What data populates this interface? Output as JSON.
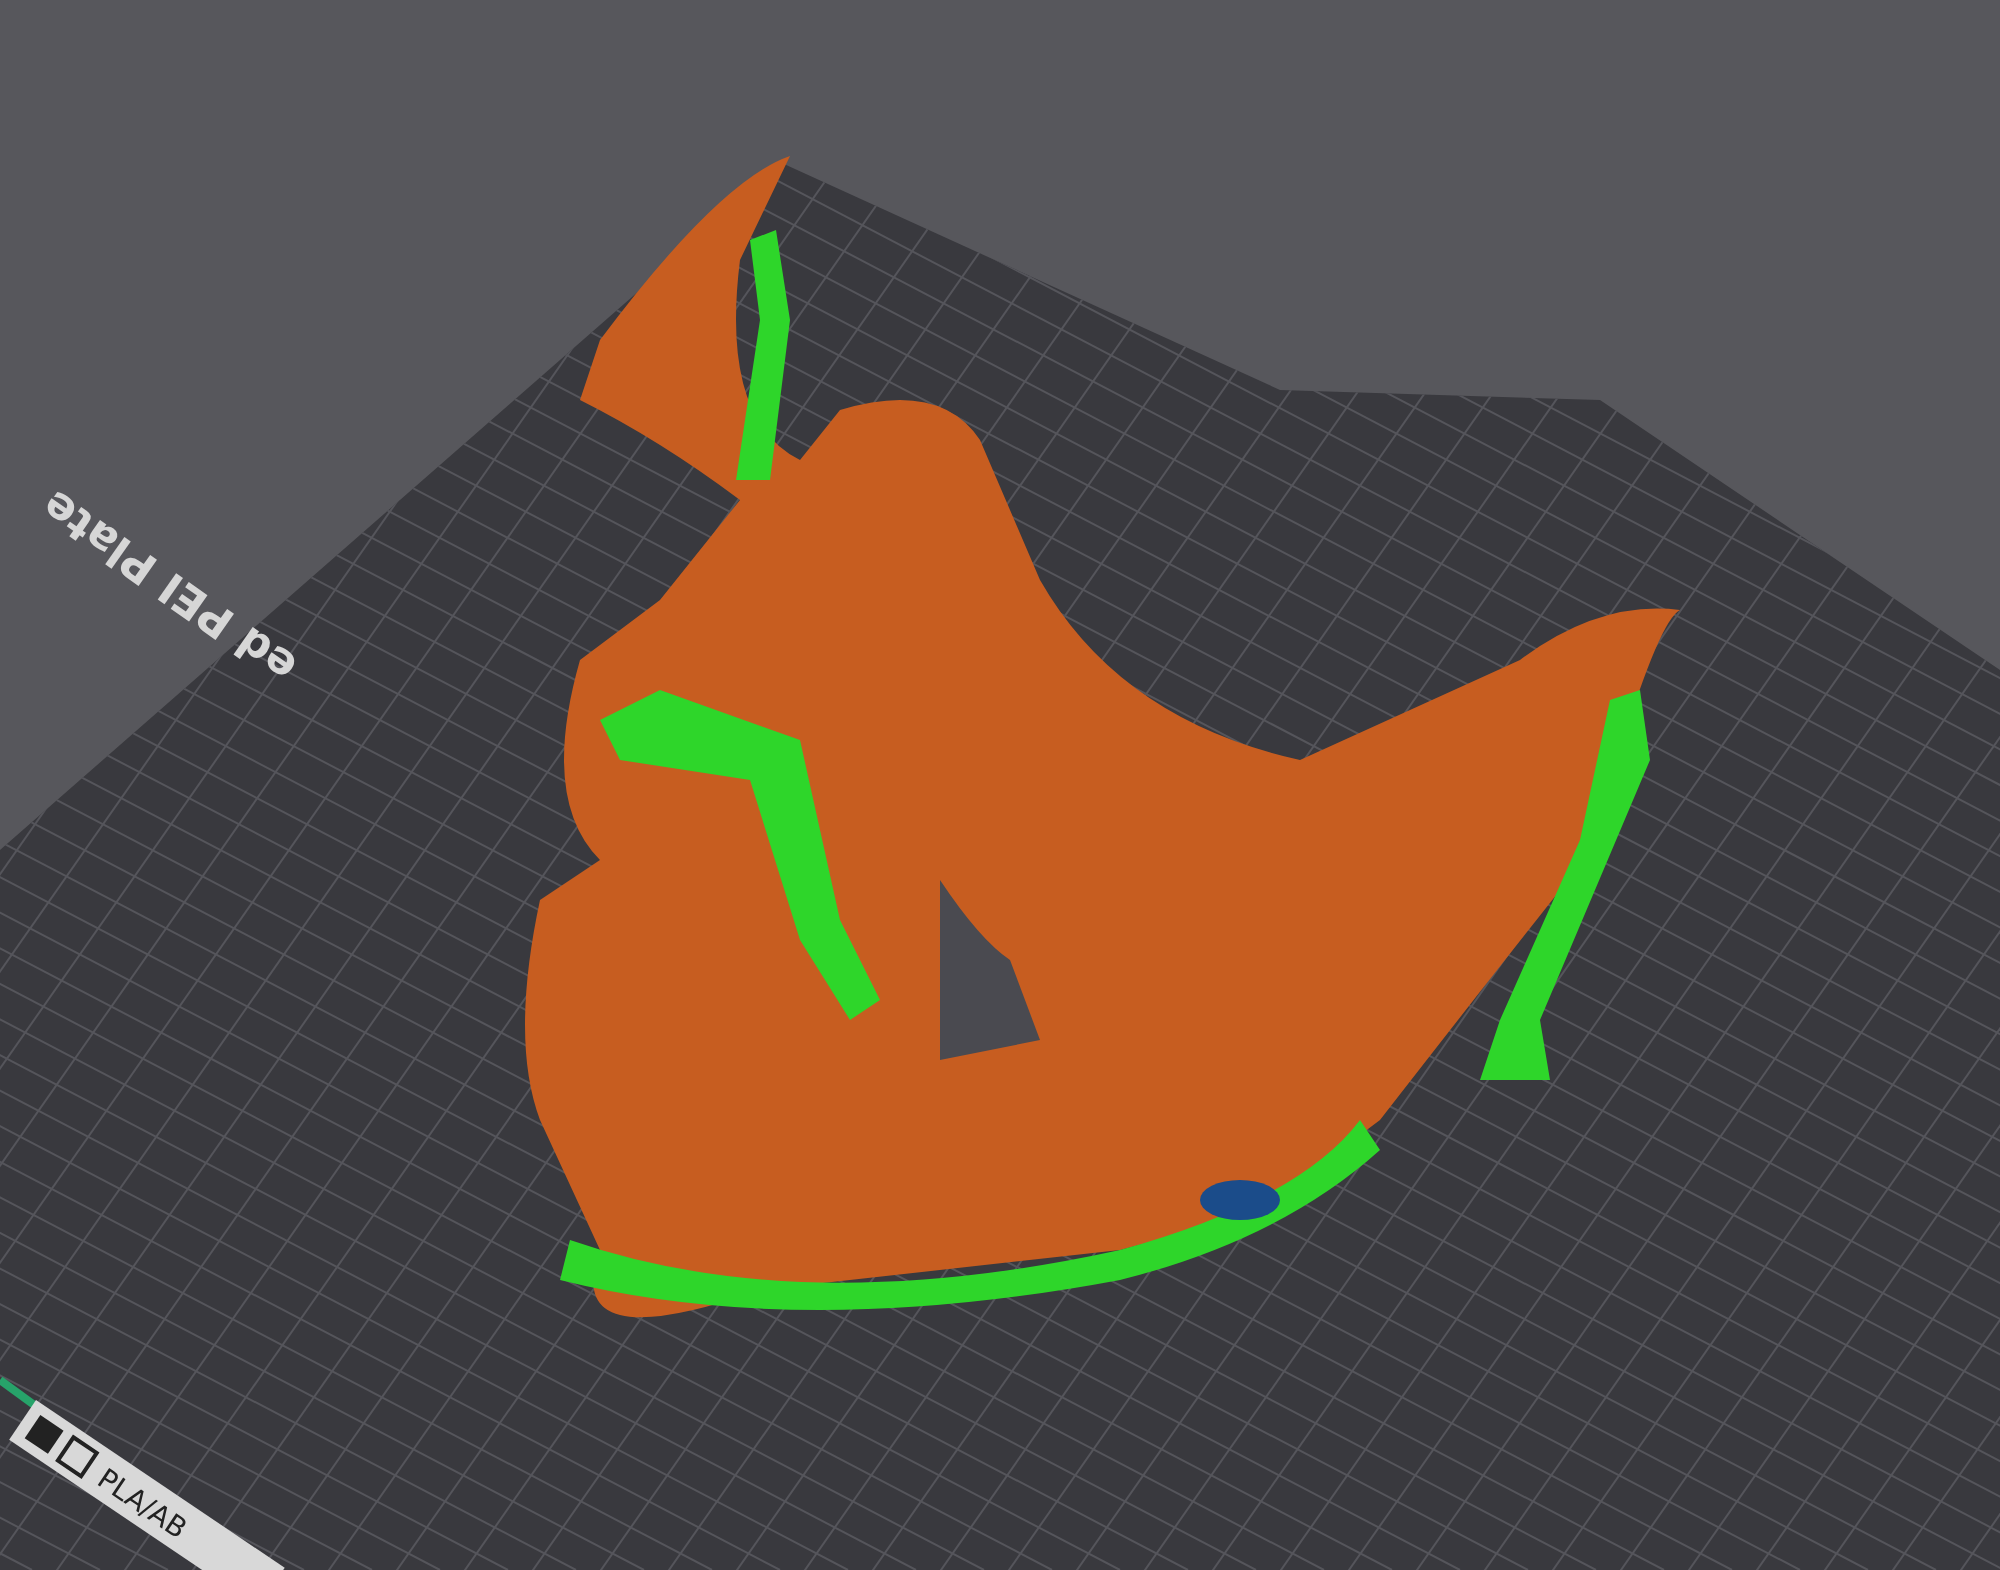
{
  "viewport": {
    "plate_label": "ed PEI Plate",
    "plate_tag": "PLA/AB"
  }
}
